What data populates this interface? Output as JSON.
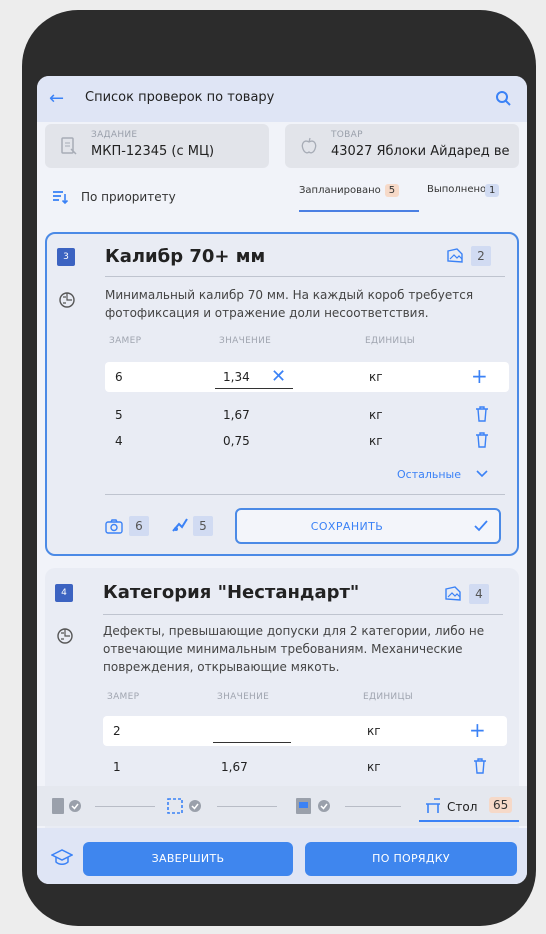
{
  "header": {
    "title": "Список проверок по товару"
  },
  "task": {
    "label": "ЗАДАНИЕ",
    "value": "МКП-12345 (с МЦ)"
  },
  "product": {
    "label": "ТОВАР",
    "value": "43027 Яблоки Айдаред ве"
  },
  "sort": {
    "label": "По приоритету"
  },
  "tabs": [
    {
      "label": "Запланировано",
      "count": "5"
    },
    {
      "label": "Выполнено",
      "count": "1"
    }
  ],
  "columns": {
    "measure": "ЗАМЕР",
    "value": "ЗНАЧЕНИЕ",
    "units": "ЕДИНИЦЫ"
  },
  "cards": [
    {
      "number": "3",
      "title": "Калибр 70+ мм",
      "photo_count": "2",
      "description": "Минимальный калибр 70 мм. На каждый короб требуется фотофиксация и отражение доли несоответствия.",
      "rows": [
        {
          "measure": "6",
          "value": "1,34",
          "unit": "кг"
        },
        {
          "measure": "5",
          "value": "1,67",
          "unit": "кг"
        },
        {
          "measure": "4",
          "value": "0,75",
          "unit": "кг"
        }
      ],
      "more_label": "Остальные",
      "camera_count": "6",
      "defect_count": "5",
      "save_label": "СОХРАНИТЬ"
    },
    {
      "number": "4",
      "title": "Категория \"Нестандарт\"",
      "photo_count": "4",
      "description": "Дефекты, превышающие допуски для 2 категории, либо не отвечающие минимальным требованиям. Механические повреждения, открывающие мякоть.",
      "rows": [
        {
          "measure": "2",
          "value": "",
          "unit": "кг"
        },
        {
          "measure": "1",
          "value": "1,67",
          "unit": "кг"
        }
      ]
    }
  ],
  "stepper": {
    "current_label": "Стол",
    "current_count": "65"
  },
  "bottom": {
    "finish_label": "ЗАВЕРШИТЬ",
    "order_label": "ПО ПОРЯДКУ"
  },
  "colors": {
    "accent": "#3f86ee",
    "badge_blue": "#3c63c1",
    "tab_planned_badge": "#f6d9c8"
  }
}
